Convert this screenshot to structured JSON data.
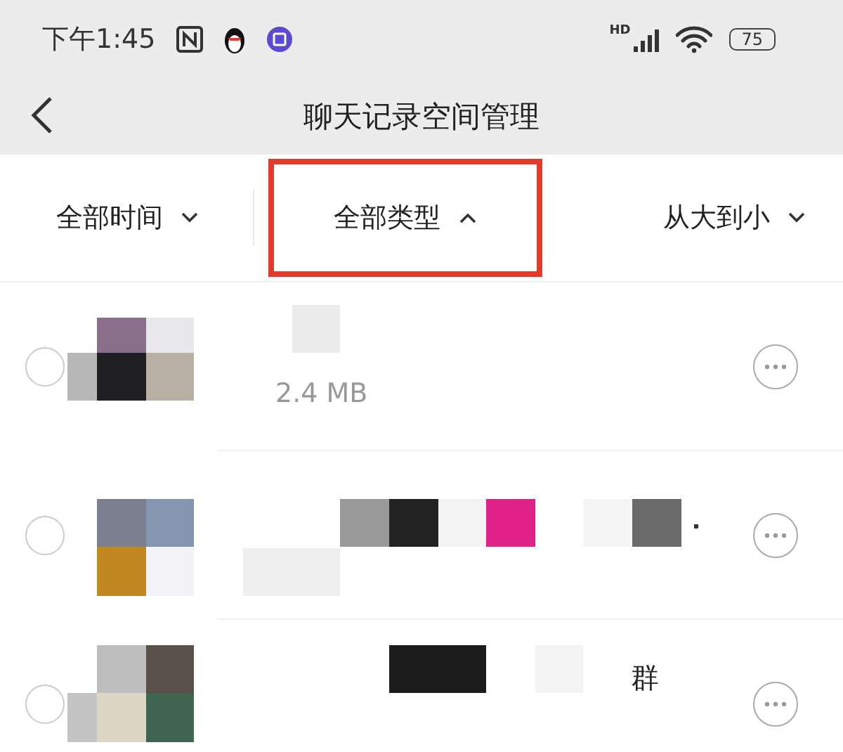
{
  "status_bar": {
    "time": "下午1:45",
    "network": "HD",
    "battery": "75"
  },
  "header": {
    "title": "聊天记录空间管理"
  },
  "filters": [
    {
      "label": "全部时间",
      "expanded": false,
      "highlighted": false
    },
    {
      "label": "全部类型",
      "expanded": true,
      "highlighted": true
    },
    {
      "label": "从大到小",
      "expanded": false,
      "highlighted": false
    }
  ],
  "rows": [
    {
      "checked": false,
      "text": "2.4 MB"
    },
    {
      "checked": false
    },
    {
      "checked": false,
      "text": "群"
    }
  ]
}
